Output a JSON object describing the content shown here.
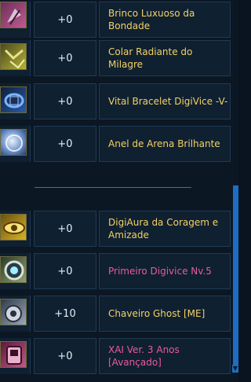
{
  "items": [
    {
      "icon": "earring-icon",
      "bonus": "+0",
      "name": "Brinco Luxuoso da\nBondade",
      "color": "yellow"
    },
    {
      "icon": "necklace-icon",
      "bonus": "+0",
      "name": "Colar Radiante do Milagre",
      "color": "yellow"
    },
    {
      "icon": "bracelet-icon",
      "bonus": "+0",
      "name": "Vital Bracelet DigiVice -V-",
      "color": "yellow"
    },
    {
      "icon": "ring-icon",
      "bonus": "+0",
      "name": "Anel de Arena Brilhante",
      "color": "yellow"
    },
    {
      "icon": "aura-eye-icon",
      "bonus": "+0",
      "name": "DigiAura da Coragem e\nAmizade",
      "color": "yellow"
    },
    {
      "icon": "digivice-icon",
      "bonus": "+0",
      "name": "Primeiro Digivice Nv.5",
      "color": "pink"
    },
    {
      "icon": "keychain-icon",
      "bonus": "+10",
      "name": "Chaveiro Ghost [ME]",
      "color": "yellow"
    },
    {
      "icon": "xai-device-icon",
      "bonus": "+0",
      "name": "XAI Ver. 3 Anos\n[Avançado]",
      "color": "pink"
    }
  ],
  "colors": {
    "name_yellow": "#f3d267",
    "name_pink": "#e85aa8",
    "accent_blue": "#1d6ec2"
  }
}
